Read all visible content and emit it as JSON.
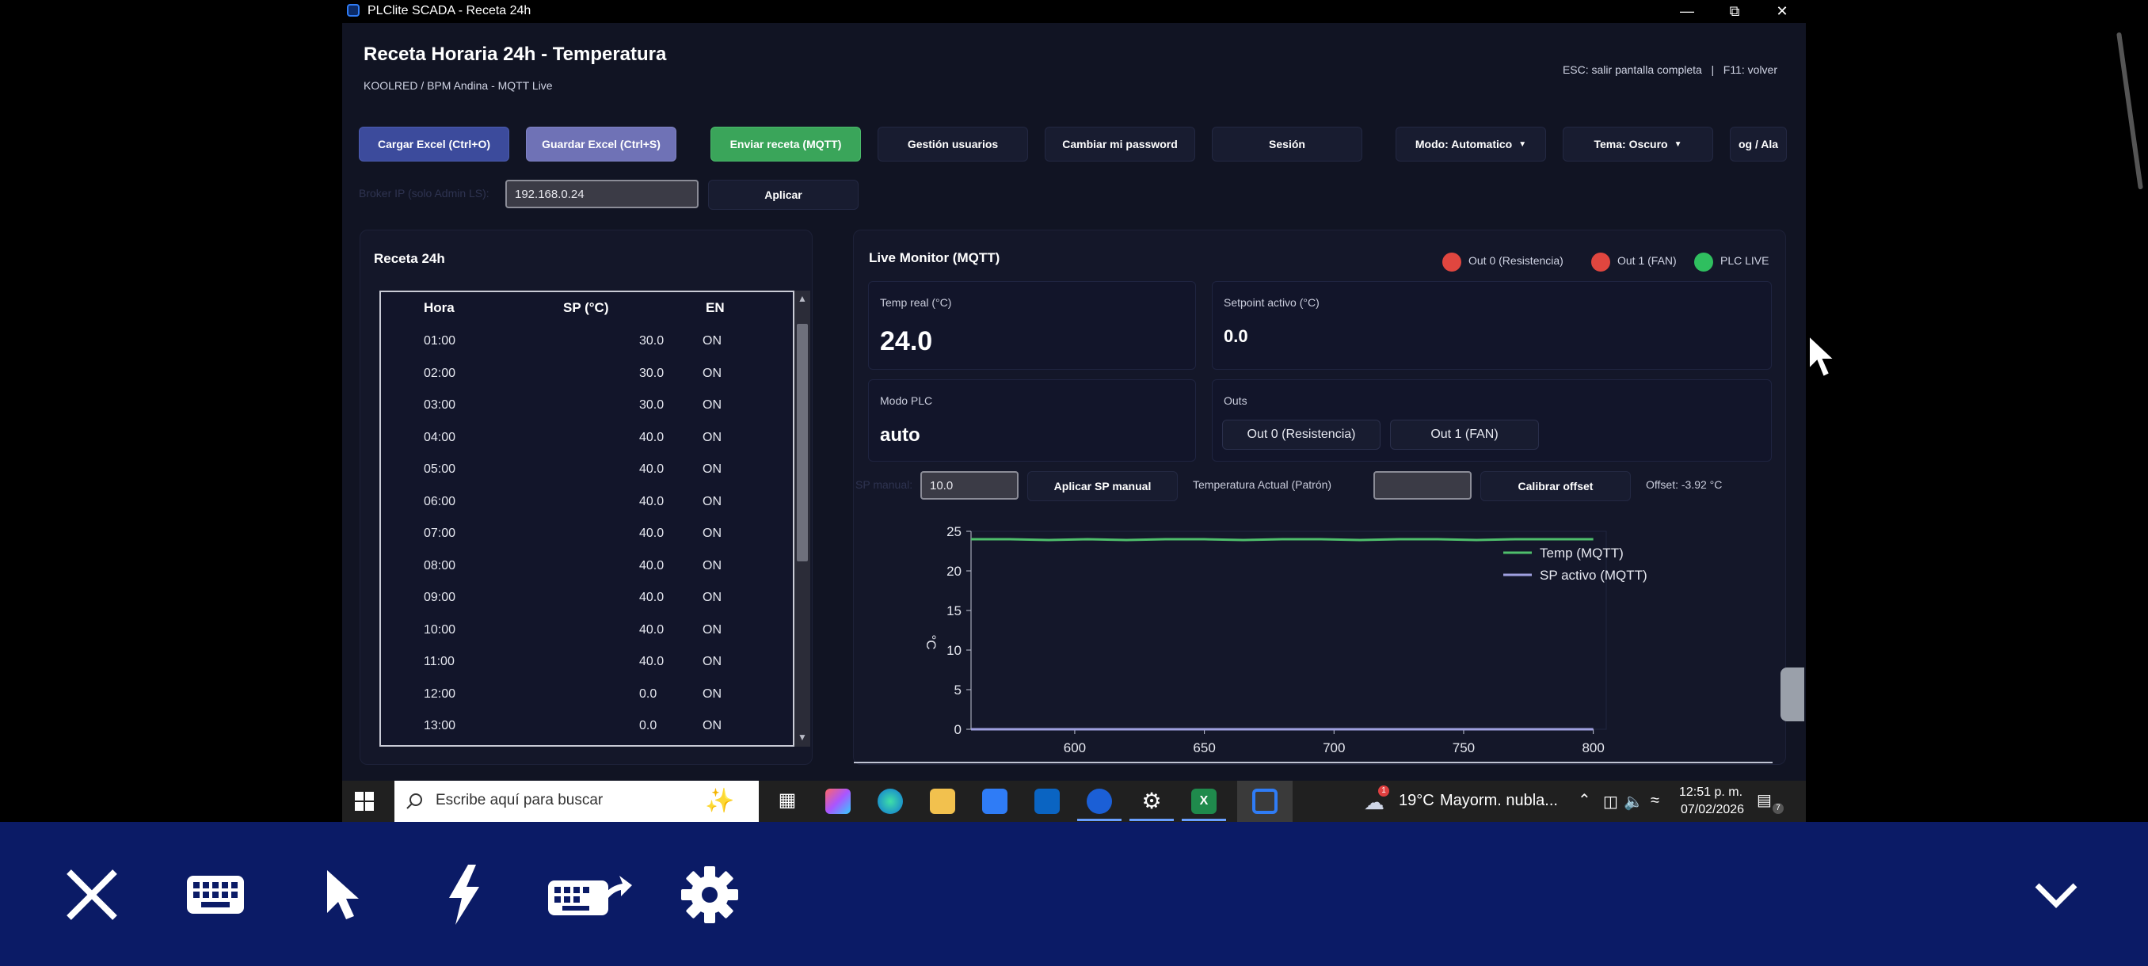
{
  "window": {
    "title": "PLClite SCADA - Receta 24h",
    "controls": [
      "minimize",
      "restore",
      "close"
    ]
  },
  "header": {
    "title": "Receta Horaria 24h - Temperatura",
    "subtitle": "KOOLRED / BPM Andina - MQTT Live",
    "hint": "ESC: salir pantalla completa   |   F11: volver"
  },
  "toolbar": {
    "load_excel": "Cargar Excel (Ctrl+O)",
    "save_excel": "Guardar Excel (Ctrl+S)",
    "send_recipe": "Enviar receta (MQTT)",
    "users": "Gestión usuarios",
    "change_password": "Cambiar mi password",
    "session": "Sesión",
    "mode": "Modo: Automatico",
    "theme": "Tema: Oscuro",
    "log": "og / Ala"
  },
  "broker": {
    "label": "Broker IP (solo Admin LS):",
    "value": "192.168.0.24",
    "apply": "Aplicar"
  },
  "recipe": {
    "title": "Receta 24h",
    "columns": [
      "Hora",
      "SP (°C)",
      "EN"
    ],
    "rows": [
      {
        "hora": "01:00",
        "sp": "30.0",
        "en": "ON"
      },
      {
        "hora": "02:00",
        "sp": "30.0",
        "en": "ON"
      },
      {
        "hora": "03:00",
        "sp": "30.0",
        "en": "ON"
      },
      {
        "hora": "04:00",
        "sp": "40.0",
        "en": "ON"
      },
      {
        "hora": "05:00",
        "sp": "40.0",
        "en": "ON"
      },
      {
        "hora": "06:00",
        "sp": "40.0",
        "en": "ON"
      },
      {
        "hora": "07:00",
        "sp": "40.0",
        "en": "ON"
      },
      {
        "hora": "08:00",
        "sp": "40.0",
        "en": "ON"
      },
      {
        "hora": "09:00",
        "sp": "40.0",
        "en": "ON"
      },
      {
        "hora": "10:00",
        "sp": "40.0",
        "en": "ON"
      },
      {
        "hora": "11:00",
        "sp": "40.0",
        "en": "ON"
      },
      {
        "hora": "12:00",
        "sp": "0.0",
        "en": "ON"
      },
      {
        "hora": "13:00",
        "sp": "0.0",
        "en": "ON"
      }
    ]
  },
  "monitor": {
    "title": "Live Monitor (MQTT)",
    "indicators": [
      {
        "label": "Out 0 (Resistencia)",
        "color": "#e0463f"
      },
      {
        "label": "Out 1 (FAN)",
        "color": "#e0463f"
      },
      {
        "label": "PLC LIVE",
        "color": "#2fbf5f"
      }
    ],
    "temp_label": "Temp real (°C)",
    "temp_value": "24.0",
    "setpoint_label": "Setpoint activo (°C)",
    "setpoint_value": "0.0",
    "mode_label": "Modo PLC",
    "mode_value": "auto",
    "outs_label": "Outs",
    "out0": "Out 0 (Resistencia)",
    "out1": "Out 1 (FAN)",
    "sp_manual_label": "SP manual:",
    "sp_manual_value": "10.0",
    "apply_sp": "Aplicar SP manual",
    "temp_actual_label": "Temperatura Actual (Patrón)",
    "temp_actual_value": "",
    "calibrate": "Calibrar offset",
    "offset": "Offset: -3.92 °C"
  },
  "chart_data": {
    "type": "line",
    "title": "",
    "xlabel": "",
    "ylabel": "°C",
    "xlim": [
      560,
      805
    ],
    "ylim": [
      0,
      25
    ],
    "xticks": [
      600,
      650,
      700,
      750,
      800
    ],
    "yticks": [
      0,
      5,
      10,
      15,
      20,
      25
    ],
    "legend_position": "top-right",
    "series": [
      {
        "name": "Temp (MQTT)",
        "color": "#4fbf6c",
        "x": [
          560,
          575,
          590,
          605,
          620,
          635,
          650,
          665,
          680,
          695,
          710,
          725,
          740,
          755,
          770,
          785,
          800
        ],
        "y": [
          24.0,
          24.0,
          23.9,
          24.0,
          23.9,
          24.0,
          24.0,
          23.9,
          24.0,
          24.0,
          23.9,
          24.0,
          24.0,
          23.9,
          24.0,
          24.0,
          24.0
        ]
      },
      {
        "name": "SP activo (MQTT)",
        "color": "#9fa0e0",
        "x": [
          560,
          800
        ],
        "y": [
          0,
          0
        ]
      }
    ]
  },
  "taskbar": {
    "search_placeholder": "Escribe aquí para buscar",
    "weather_temp": "19°C",
    "weather_text": "Mayorm. nubla...",
    "weather_badge": "1",
    "time": "12:51 p. m.",
    "date": "07/02/2026",
    "notifications": "7"
  }
}
